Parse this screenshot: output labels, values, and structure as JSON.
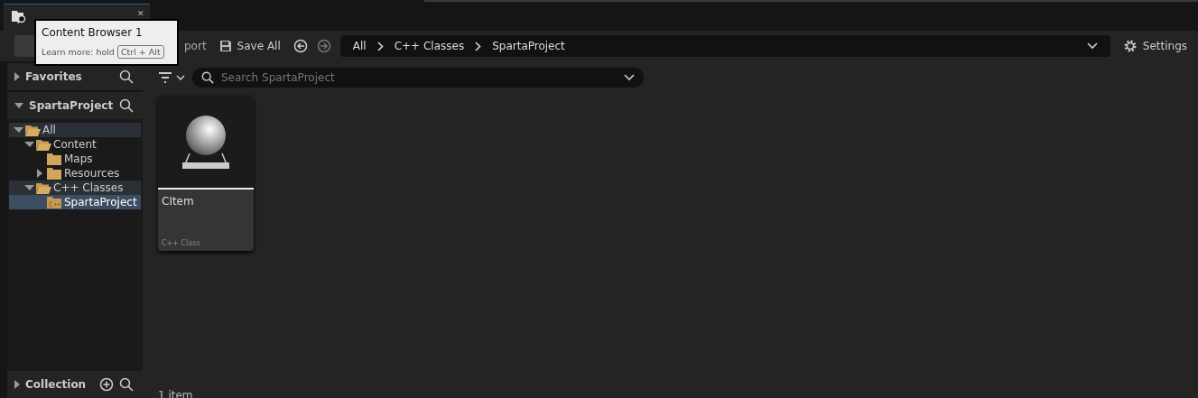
{
  "tab": {
    "close": "✕"
  },
  "tooltip": {
    "title": "Content Browser 1",
    "hint": "Learn more: hold",
    "shortcut": "Ctrl + Alt"
  },
  "toolbar": {
    "import_label": "port",
    "save_label": "Save All",
    "breadcrumbs": [
      "All",
      "C++ Classes",
      "SpartaProject"
    ],
    "settings_label": "Settings"
  },
  "sidebar": {
    "favorites": {
      "title": "Favorites",
      "expanded": false
    },
    "project": {
      "title": "SpartaProject",
      "expanded": true
    },
    "tree": [
      {
        "label": "All",
        "kind": "folder",
        "expanded": true,
        "highlighted": true,
        "selected": false,
        "children": [
          {
            "label": "Content",
            "kind": "folder",
            "expanded": true,
            "highlighted": false,
            "selected": false,
            "children": [
              {
                "label": "Maps",
                "kind": "folder",
                "expanded": false,
                "highlighted": false,
                "selected": false
              },
              {
                "label": "Resources",
                "kind": "folder",
                "expanded": false,
                "has_children": true,
                "highlighted": false,
                "selected": false
              }
            ]
          },
          {
            "label": "C++ Classes",
            "kind": "folder",
            "expanded": true,
            "highlighted": true,
            "selected": false,
            "children": [
              {
                "label": "SpartaProject",
                "kind": "cpp-folder",
                "expanded": false,
                "highlighted": false,
                "selected": true
              }
            ]
          }
        ]
      }
    ],
    "collections": {
      "title": "Collection",
      "expanded": false
    }
  },
  "search": {
    "placeholder": "Search SpartaProject"
  },
  "assets": [
    {
      "name": "CItem",
      "type": "C++ Class"
    }
  ],
  "status": "1 item"
}
